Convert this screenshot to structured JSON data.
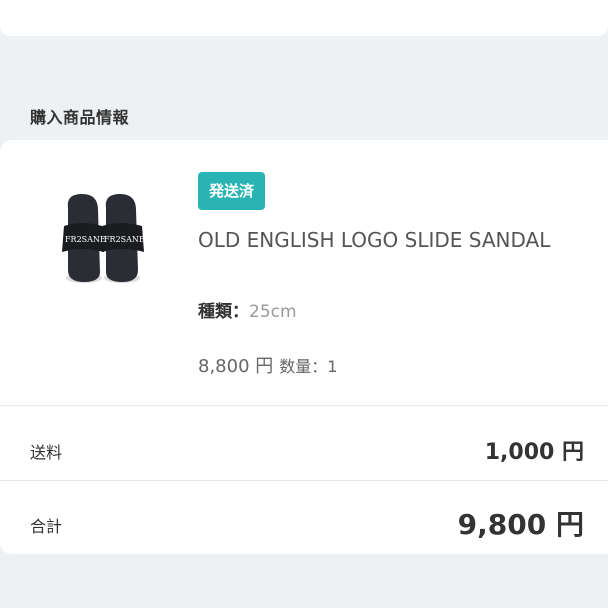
{
  "section": {
    "title": "購入商品情報"
  },
  "product": {
    "status_badge": "発送済",
    "name": "OLD ENGLISH LOGO SLIDE SANDAL",
    "variant_label": "種類：",
    "variant_value": "25cm",
    "price": "8,800 円",
    "quantity": "数量：1",
    "logo_text": "FR2SANE"
  },
  "summary": {
    "shipping_label": "送料",
    "shipping_value": "1,000 円",
    "total_label": "合計",
    "total_value": "9,800 円"
  },
  "colors": {
    "badge": "#29b3b3",
    "background": "#eef1f3"
  }
}
